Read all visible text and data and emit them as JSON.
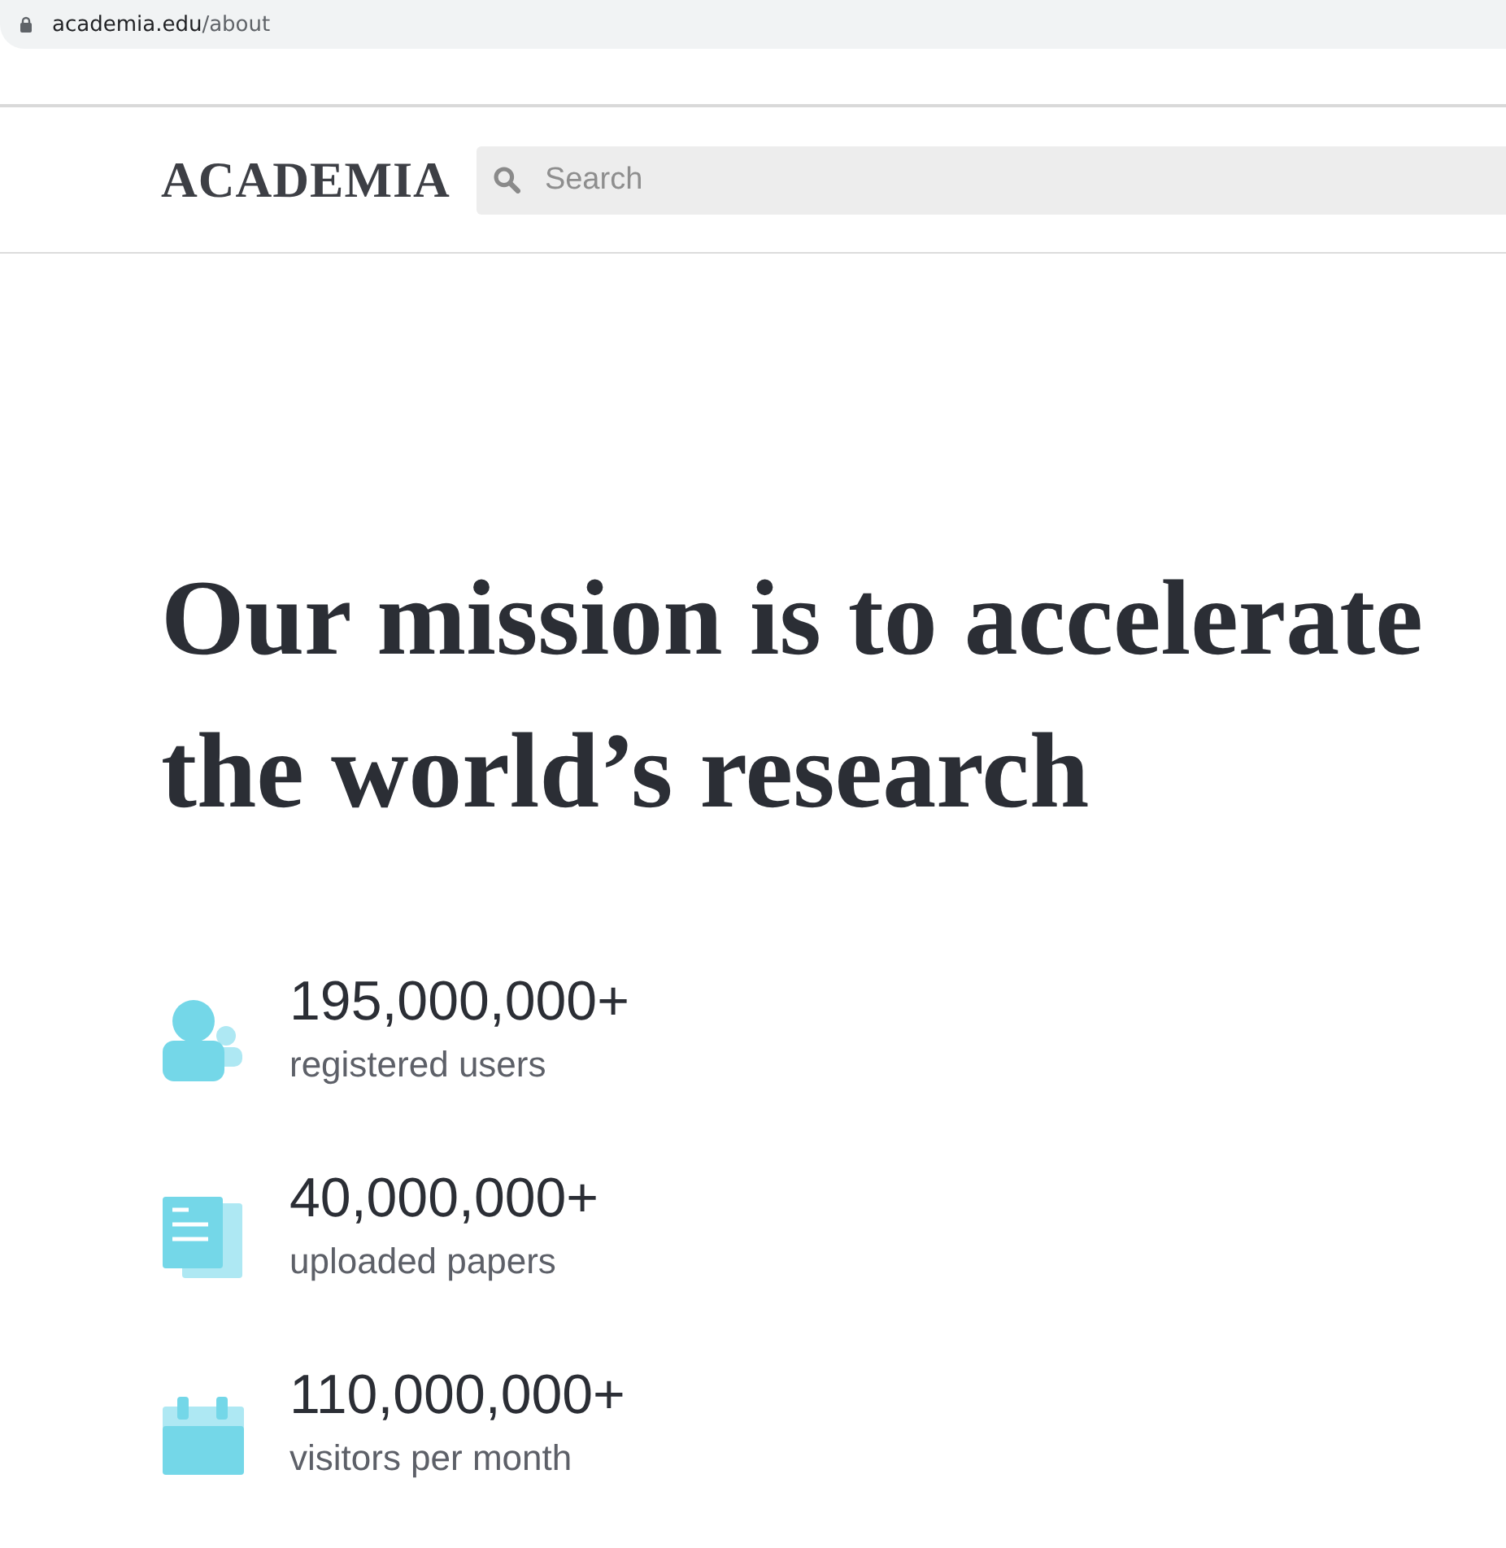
{
  "browser": {
    "url_host": "academia.edu",
    "url_path": "/about"
  },
  "header": {
    "logo": "ACADEMIA",
    "search": {
      "placeholder": "Search"
    }
  },
  "heading": [
    "Our mission is to accelerate",
    "the world’s research"
  ],
  "stats": [
    {
      "kind": "users",
      "value": "195,000,000+",
      "label": "registered users"
    },
    {
      "kind": "papers",
      "value": "40,000,000+",
      "label": "uploaded papers"
    },
    {
      "kind": "calendar",
      "value": "110,000,000+",
      "label": "visitors per month"
    }
  ]
}
